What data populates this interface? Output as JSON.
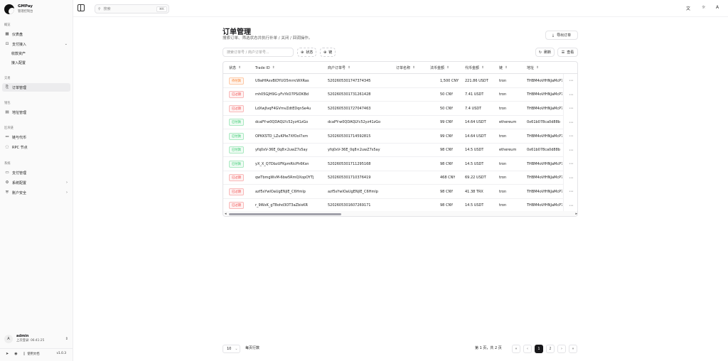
{
  "brand": {
    "name": "GMPay",
    "subtitle": "管理控制台"
  },
  "sidebar": {
    "groups": [
      {
        "label": "概览"
      },
      {
        "label": "交易"
      },
      {
        "label": "钱包"
      },
      {
        "label": "区块链"
      },
      {
        "label": "系统"
      }
    ],
    "items": [
      {
        "label": "仪表盘",
        "icon": "▦"
      },
      {
        "label": "支付接入",
        "icon": "⊡"
      },
      {
        "label": "收款资产"
      },
      {
        "label": "接入配置"
      },
      {
        "label": "订单管理",
        "icon": "⎘"
      },
      {
        "label": "地址管理",
        "icon": "▤"
      },
      {
        "label": "链与代币",
        "icon": "⚯"
      },
      {
        "label": "RPC 节点",
        "icon": "◌"
      },
      {
        "label": "支付管理",
        "icon": "▭"
      },
      {
        "label": "系统配置",
        "icon": "⚙"
      },
      {
        "label": "账户安全",
        "icon": "⛨"
      }
    ],
    "user": {
      "avatar": "A",
      "name": "admin",
      "last_login": "上次登录: 06:41:25"
    },
    "footer": {
      "docs": "使用文档",
      "version": "v1.0.3"
    }
  },
  "topbar": {
    "search_placeholder": "搜索",
    "shortcut": "⌘K"
  },
  "page": {
    "title": "订单管理",
    "description": "搜索订单、筛选状态并执行补单 / 关闭 / 回调操作。",
    "export_label": "导出订单",
    "filter_placeholder": "搜索订单号 / 商户订单号...",
    "status_filter": "状态",
    "chain_filter": "链",
    "refresh_label": "刷新",
    "view_label": "查看"
  },
  "table": {
    "columns": [
      "状态",
      "Trade ID",
      "商户订单号",
      "订单名称",
      "法币金额",
      "代币金额",
      "链",
      "地址"
    ],
    "rows": [
      {
        "status": "待付款",
        "status_type": "pending",
        "trade_id": "U9aHfAsvBlDYUO5mrrcWXRas",
        "merchant_id": "5202605301747374345",
        "name": "",
        "fiat": "1,500 CNY",
        "token": "221.86 USDT",
        "chain": "tron",
        "address": "THBM4oVfHNJaMcP7"
      },
      {
        "status": "已过期",
        "status_type": "expired",
        "trade_id": "mh05GJH9G-yFsYkO7PSiDKBd",
        "merchant_id": "5202605301731261428",
        "name": "",
        "fiat": "50 CNY",
        "token": "7.41 USDT",
        "chain": "tron",
        "address": "THBM4oVfHNJaMcP7"
      },
      {
        "status": "已过期",
        "status_type": "expired",
        "trade_id": "LdXwJlvqF4GVmvZdtEDqnSe4u",
        "merchant_id": "5202605301727047463",
        "name": "",
        "fiat": "50 CNY",
        "token": "7.4 USDT",
        "chain": "tron",
        "address": "THBM4oVfHNJaMcP7"
      },
      {
        "status": "已付款",
        "status_type": "paid",
        "trade_id": "dcaPY-w0QDAQLYc52yz41zGo",
        "merchant_id": "dcaPY-w0QDAQLYc52yz41zGo",
        "name": "",
        "fiat": "99 CNY",
        "token": "14.64 USDT",
        "chain": "ethereum",
        "address": "0x61b078ca0d88b"
      },
      {
        "status": "已付款",
        "status_type": "paid",
        "trade_id": "OPKKSTD_LZuKPIe7XfOol7xm",
        "merchant_id": "5202605301714592815",
        "name": "",
        "fiat": "99 CNY",
        "token": "14.64 USDT",
        "chain": "tron",
        "address": "THBM4oVfHNJaMcP7"
      },
      {
        "status": "已付款",
        "status_type": "paid",
        "trade_id": "yfq0xV-36E_0q8×2uwZ7s5ay",
        "merchant_id": "yfq0xV-36E_0q8×2uwZ7s5ay",
        "name": "",
        "fiat": "98 CNY",
        "token": "14.5 USDT",
        "chain": "ethereum",
        "address": "0x61b078ca0d88b"
      },
      {
        "status": "已付款",
        "status_type": "paid",
        "trade_id": "yX_X_Q7DbzUFKpmRlcPh6Ksn",
        "merchant_id": "5202605301711295168",
        "name": "",
        "fiat": "98 CNY",
        "token": "14.5 USDT",
        "chain": "tron",
        "address": "THBM4oVfHNJaMcP7"
      },
      {
        "status": "已过期",
        "status_type": "expired",
        "trade_id": "qwTbmgWvM-6bw5RmQXopOYTj",
        "merchant_id": "5202605301710376419",
        "name": "",
        "fiat": "468 CNY",
        "token": "69.22 USDT",
        "chain": "tron",
        "address": "THBM4oVfHNJaMcP7"
      },
      {
        "status": "已过期",
        "status_type": "expired",
        "trade_id": "azf5sYwIOaUgENjlE_C6Hmlp",
        "merchant_id": "azf5sYwIOaUgENjlE_C6Hmlp",
        "name": "",
        "fiat": "98 CNY",
        "token": "41.38 TRX",
        "chain": "tron",
        "address": "THBM4oVfHNJaMcP7"
      },
      {
        "status": "已过期",
        "status_type": "expired",
        "trade_id": "r_9WxK_gT8ohd3OT3aZbisKR",
        "merchant_id": "5202605301607269171",
        "name": "",
        "fiat": "98 CNY",
        "token": "14.5 USDT",
        "chain": "tron",
        "address": "THBM4oVfHNJaMcP7"
      }
    ]
  },
  "pagination": {
    "page_size": "10",
    "per_page_label": "每页行数",
    "page_info": "第 1 页，共 2 页",
    "pages": [
      "1",
      "2"
    ],
    "current": "1"
  },
  "colors": {
    "pending": "#f97316",
    "expired": "#ef4444",
    "paid": "#22c55e",
    "accent": "#18181b"
  }
}
